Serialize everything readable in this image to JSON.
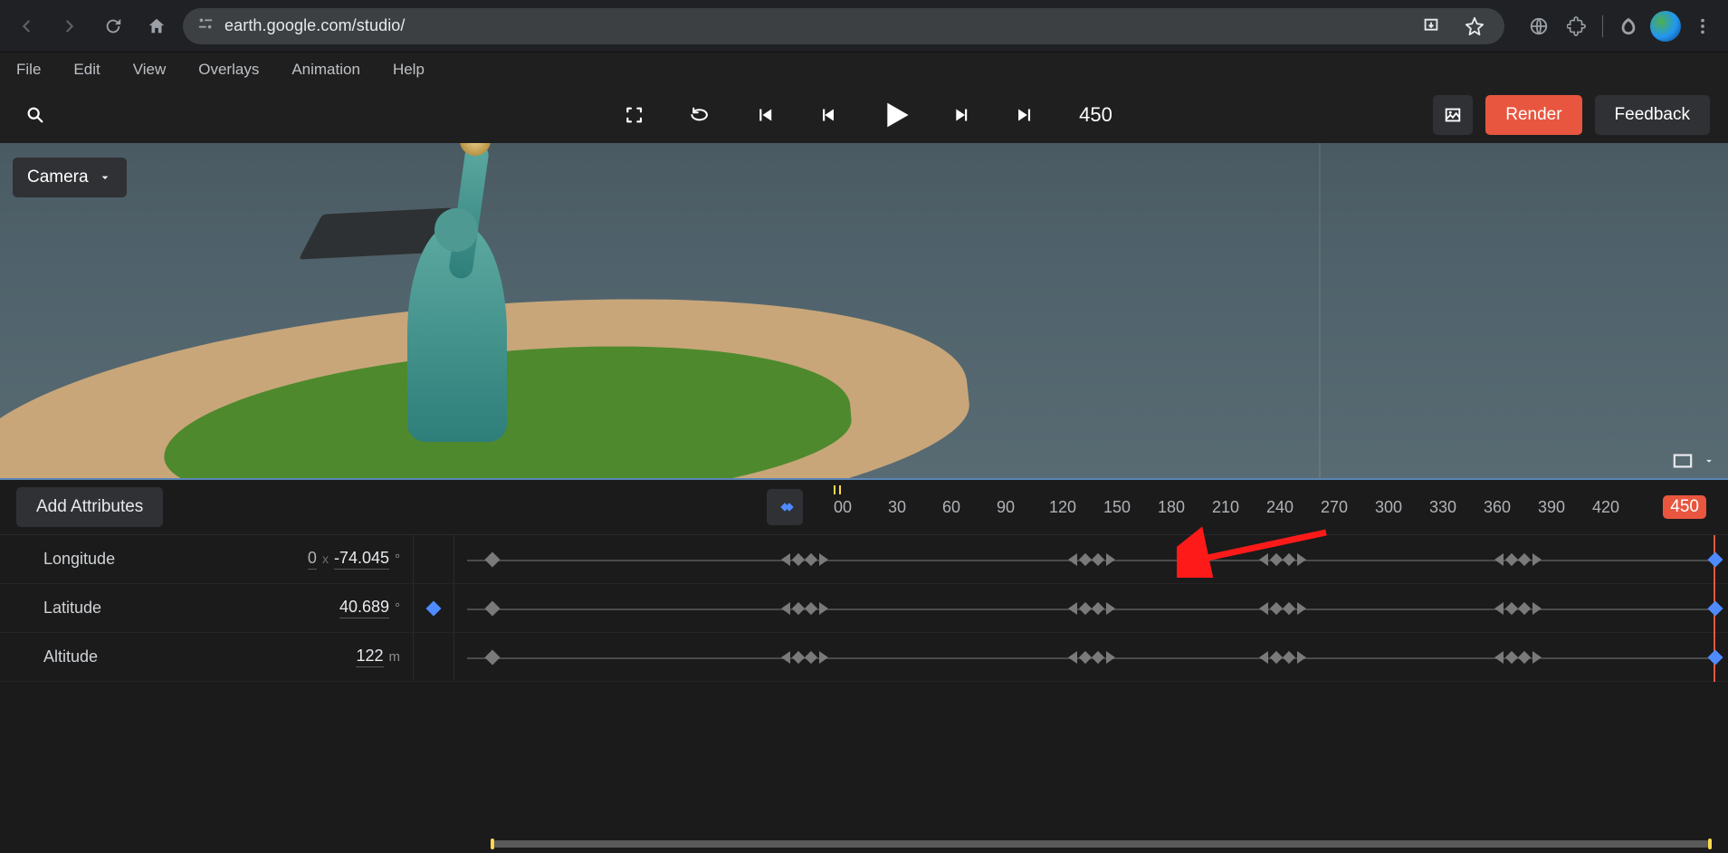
{
  "browser": {
    "url": "earth.google.com/studio/"
  },
  "menubar": [
    "File",
    "Edit",
    "View",
    "Overlays",
    "Animation",
    "Help"
  ],
  "toolbar": {
    "frame": "450",
    "render_label": "Render",
    "feedback_label": "Feedback"
  },
  "viewport": {
    "camera_chip": "Camera"
  },
  "timeline": {
    "add_attr_label": "Add Attributes",
    "ruler_ticks": [
      "00",
      "30",
      "60",
      "90",
      "120",
      "150",
      "180",
      "210",
      "240",
      "270",
      "300",
      "330",
      "360",
      "390",
      "420"
    ],
    "playhead_badge": "450",
    "rows": [
      {
        "label": "Longitude",
        "prefix": "0",
        "value": "-74.045",
        "unit": "°",
        "has_blue_kf": false
      },
      {
        "label": "Latitude",
        "prefix": "",
        "value": "40.689",
        "unit": "°",
        "has_blue_kf": true
      },
      {
        "label": "Altitude",
        "prefix": "",
        "value": "122",
        "unit": "m",
        "has_blue_kf": false
      }
    ],
    "keyframe_positions_pct": [
      3,
      27.5,
      50,
      65,
      83.5,
      99
    ],
    "keyframe_pair_indices": [
      1,
      2,
      3,
      4
    ]
  }
}
